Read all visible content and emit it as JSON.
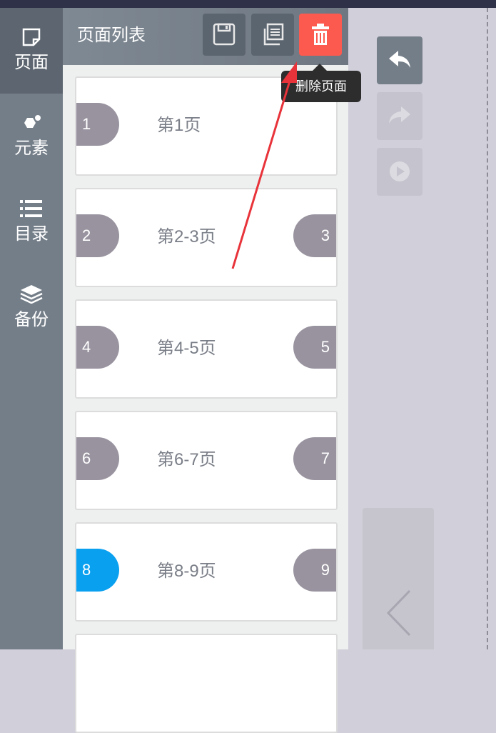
{
  "sidenav": {
    "items": [
      {
        "label": "页面",
        "icon": "page-icon"
      },
      {
        "label": "元素",
        "icon": "elements-icon"
      },
      {
        "label": "目录",
        "icon": "list-icon"
      },
      {
        "label": "备份",
        "icon": "layers-icon"
      }
    ]
  },
  "panel": {
    "title": "页面列表",
    "buttons": {
      "save": "save-icon",
      "copy": "copy-icon",
      "delete": "trash-icon"
    },
    "tooltip": "删除页面",
    "cards": [
      {
        "left": "1",
        "right": "",
        "label": "第1页"
      },
      {
        "left": "2",
        "right": "3",
        "label": "第2-3页"
      },
      {
        "left": "4",
        "right": "5",
        "label": "第4-5页"
      },
      {
        "left": "6",
        "right": "7",
        "label": "第6-7页"
      },
      {
        "left": "8",
        "right": "9",
        "label": "第8-9页"
      }
    ]
  },
  "colors": {
    "accent": "#0aa0f0",
    "delete": "#fc5a4e",
    "sidebar": "#747e89",
    "annotation_arrow": "#e8333a"
  },
  "toolbar": {
    "undo": "undo-icon",
    "redo": "redo-icon",
    "play": "play-icon",
    "prev": "chevron-left-icon"
  }
}
